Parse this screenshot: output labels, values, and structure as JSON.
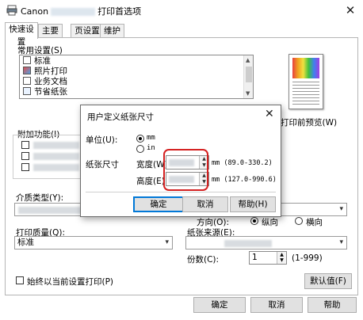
{
  "window": {
    "title_prefix": "Canon",
    "title_suffix": "打印首选项",
    "close_glyph": "✕"
  },
  "tabs": [
    {
      "label": "快速设置",
      "active": true
    },
    {
      "label": "主要"
    },
    {
      "label": "页设置"
    },
    {
      "label": "维护"
    }
  ],
  "common_settings": {
    "label": "常用设置(S)",
    "items": [
      "标准",
      "照片打印",
      "业务文档",
      "节省纸张"
    ]
  },
  "preview_label": "打印前预览(W)",
  "additional_features": {
    "label": "附加功能(I)"
  },
  "media_type": {
    "label": "介质类型(Y):"
  },
  "orientation": {
    "label": "方向(O):",
    "portrait": "纵向",
    "landscape": "横向",
    "selected": "portrait"
  },
  "print_quality": {
    "label": "打印质量(Q):",
    "value": "标准"
  },
  "paper_source": {
    "label": "纸张来源(E):"
  },
  "copies": {
    "label": "份数(C):",
    "value": "1",
    "range": "(1-999)"
  },
  "always_print_current": "始终以当前设置打印(P)",
  "defaults_button": "默认值(F)",
  "footer": {
    "ok": "确定",
    "cancel": "取消",
    "help": "帮助"
  },
  "dialog": {
    "title": "用户定义纸张尺寸",
    "close_glyph": "✕",
    "unit_label": "单位(U):",
    "unit_mm": "mm",
    "unit_in": "in",
    "unit_selected": "mm",
    "paper_size_label": "纸张尺寸",
    "width_label": "宽度(W):",
    "width_unit": "mm",
    "width_range": "(89.0-330.2)",
    "height_label": "高度(E):",
    "height_unit": "mm",
    "height_range": "(127.0-990.6)",
    "ok": "确定",
    "cancel": "取消",
    "help": "帮助(H)"
  },
  "colors": {
    "accent": "#0078d7",
    "highlight_box": "#d42020"
  },
  "icons": [
    "canon-app-icon",
    "close-icon",
    "chevron-down-icon",
    "spin-up-icon",
    "spin-down-icon"
  ]
}
